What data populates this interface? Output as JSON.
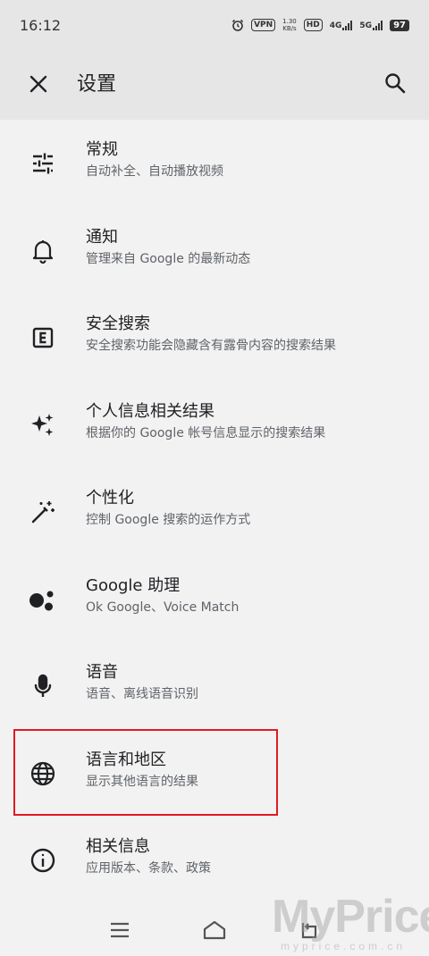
{
  "status_bar": {
    "time": "16:12",
    "vpn": "VPN",
    "speed_value": "1.30",
    "speed_unit": "KB/s",
    "hd": "HD",
    "network1": "4G",
    "network2": "5G",
    "battery": "97"
  },
  "app_bar": {
    "title": "设置"
  },
  "items": [
    {
      "label": "常规",
      "sub": "自动补全、自动播放视频",
      "icon": "tune-icon"
    },
    {
      "label": "通知",
      "sub": "管理来自 Google 的最新动态",
      "icon": "bell-icon"
    },
    {
      "label": "安全搜索",
      "sub": "安全搜索功能会隐藏含有露骨内容的搜索结果",
      "icon": "explicit-icon"
    },
    {
      "label": "个人信息相关结果",
      "sub": "根据你的 Google 帐号信息显示的搜索结果",
      "icon": "sparkle-icon"
    },
    {
      "label": "个性化",
      "sub": "控制 Google 搜索的运作方式",
      "icon": "magic-wand-icon"
    },
    {
      "label": "Google 助理",
      "sub": "Ok Google、Voice Match",
      "icon": "assistant-icon"
    },
    {
      "label": "语音",
      "sub": "语音、离线语音识别",
      "icon": "mic-icon"
    },
    {
      "label": "语言和地区",
      "sub": "显示其他语言的结果",
      "icon": "globe-icon"
    },
    {
      "label": "相关信息",
      "sub": "应用版本、条款、政策",
      "icon": "info-icon"
    }
  ],
  "watermark": {
    "brand": "MyPrice",
    "domain": "myprice.com.cn"
  },
  "colors": {
    "highlight": "#e01b24",
    "app_bar_bg": "#e6e6e6",
    "page_bg": "#f2f2f2"
  }
}
